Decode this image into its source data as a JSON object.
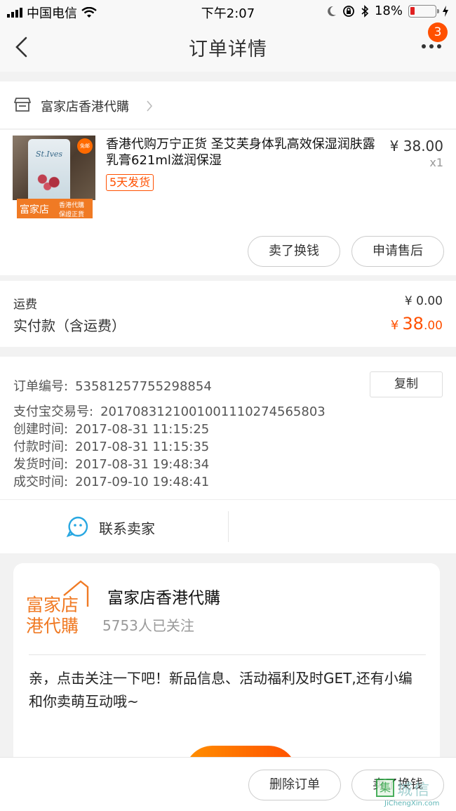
{
  "status_bar": {
    "carrier": "中国电信",
    "time": "下午2:07",
    "battery": "18%",
    "battery_level": 0.18
  },
  "nav": {
    "title": "订单详情",
    "badge_count": "3"
  },
  "shop": {
    "name": "富家店香港代購"
  },
  "product": {
    "title": "香港代购万宁正货 圣艾芙身体乳高效保湿润肤露乳膏621ml滋润保湿",
    "tag": "5天发货",
    "price": "¥ 38.00",
    "quantity": "x1",
    "thumb_bottle_brand": "St.Ives",
    "thumb_badge": "免邮",
    "thumb_brand_main": "富家店",
    "thumb_brand_sub1": "香港代購",
    "thumb_brand_sub2": "保證正貨",
    "sell_button": "卖了换钱",
    "after_sale_button": "申请售后"
  },
  "totals": {
    "shipping_label": "运费",
    "shipping_value": "¥ 0.00",
    "paid_label": "实付款（含运费）",
    "paid_symbol": "¥",
    "paid_int": "38",
    "paid_dec": ".00"
  },
  "order_info": {
    "copy_button": "复制",
    "rows": [
      {
        "label": "订单编号:",
        "value": "53581257755298854"
      },
      {
        "label": "支付宝交易号:",
        "value": "2017083121001001110274565803"
      },
      {
        "label": "创建时间:",
        "value": "2017-08-31 11:15:25"
      },
      {
        "label": "付款时间:",
        "value": "2017-08-31 11:15:35"
      },
      {
        "label": "发货时间:",
        "value": "2017-08-31 19:48:34"
      },
      {
        "label": "成交时间:",
        "value": "2017-09-10 19:48:41"
      }
    ]
  },
  "contact": {
    "label": "联系卖家"
  },
  "follow_card": {
    "logo_line1": "富家店",
    "logo_line2": "港代購",
    "shop_name": "富家店香港代購",
    "followers": "5753人已关注",
    "message": "亲，点击关注一下吧！新品信息、活动福利及时GET,还有小编和你卖萌互动哦~"
  },
  "bottom_bar": {
    "delete_button": "删除订单",
    "sell_button": "卖了换钱"
  },
  "watermark": {
    "mark": "集",
    "text": "城信",
    "url": "JiChengXin.com"
  },
  "colors": {
    "accent": "#ff5000",
    "brand_orange": "#f07a24"
  }
}
